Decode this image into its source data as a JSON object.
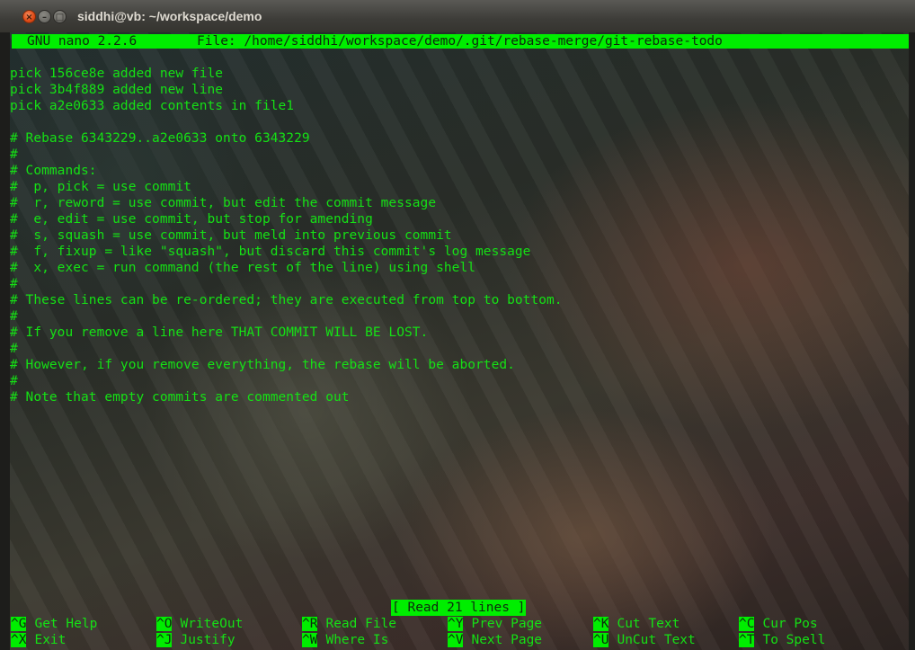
{
  "window": {
    "title": "siddhi@vb: ~/workspace/demo",
    "close_glyph": "×",
    "min_glyph": "–",
    "max_glyph": "□"
  },
  "nano": {
    "version": "GNU nano 2.2.6",
    "file": "File: /home/siddhi/workspace/demo/.git/rebase-merge/git-rebase-todo",
    "lines": [
      "pick 156ce8e added new file",
      "pick 3b4f889 added new line",
      "pick a2e0633 added contents in file1",
      "",
      "# Rebase 6343229..a2e0633 onto 6343229",
      "#",
      "# Commands:",
      "#  p, pick = use commit",
      "#  r, reword = use commit, but edit the commit message",
      "#  e, edit = use commit, but stop for amending",
      "#  s, squash = use commit, but meld into previous commit",
      "#  f, fixup = like \"squash\", but discard this commit's log message",
      "#  x, exec = run command (the rest of the line) using shell",
      "#",
      "# These lines can be re-ordered; they are executed from top to bottom.",
      "#",
      "# If you remove a line here THAT COMMIT WILL BE LOST.",
      "#",
      "# However, if you remove everything, the rebase will be aborted.",
      "#",
      "# Note that empty commits are commented out"
    ],
    "status": "[ Read 21 lines ]",
    "shortcuts": [
      {
        "key": "^G",
        "label": "Get Help"
      },
      {
        "key": "^O",
        "label": "WriteOut"
      },
      {
        "key": "^R",
        "label": "Read File"
      },
      {
        "key": "^Y",
        "label": "Prev Page"
      },
      {
        "key": "^K",
        "label": "Cut Text"
      },
      {
        "key": "^C",
        "label": "Cur Pos"
      },
      {
        "key": "^X",
        "label": "Exit"
      },
      {
        "key": "^J",
        "label": "Justify"
      },
      {
        "key": "^W",
        "label": "Where Is"
      },
      {
        "key": "^V",
        "label": "Next Page"
      },
      {
        "key": "^U",
        "label": "UnCut Text"
      },
      {
        "key": "^T",
        "label": "To Spell"
      }
    ]
  },
  "colors": {
    "text": "#15e015",
    "highlight": "#00ee00",
    "close_button": "#dd4814"
  }
}
